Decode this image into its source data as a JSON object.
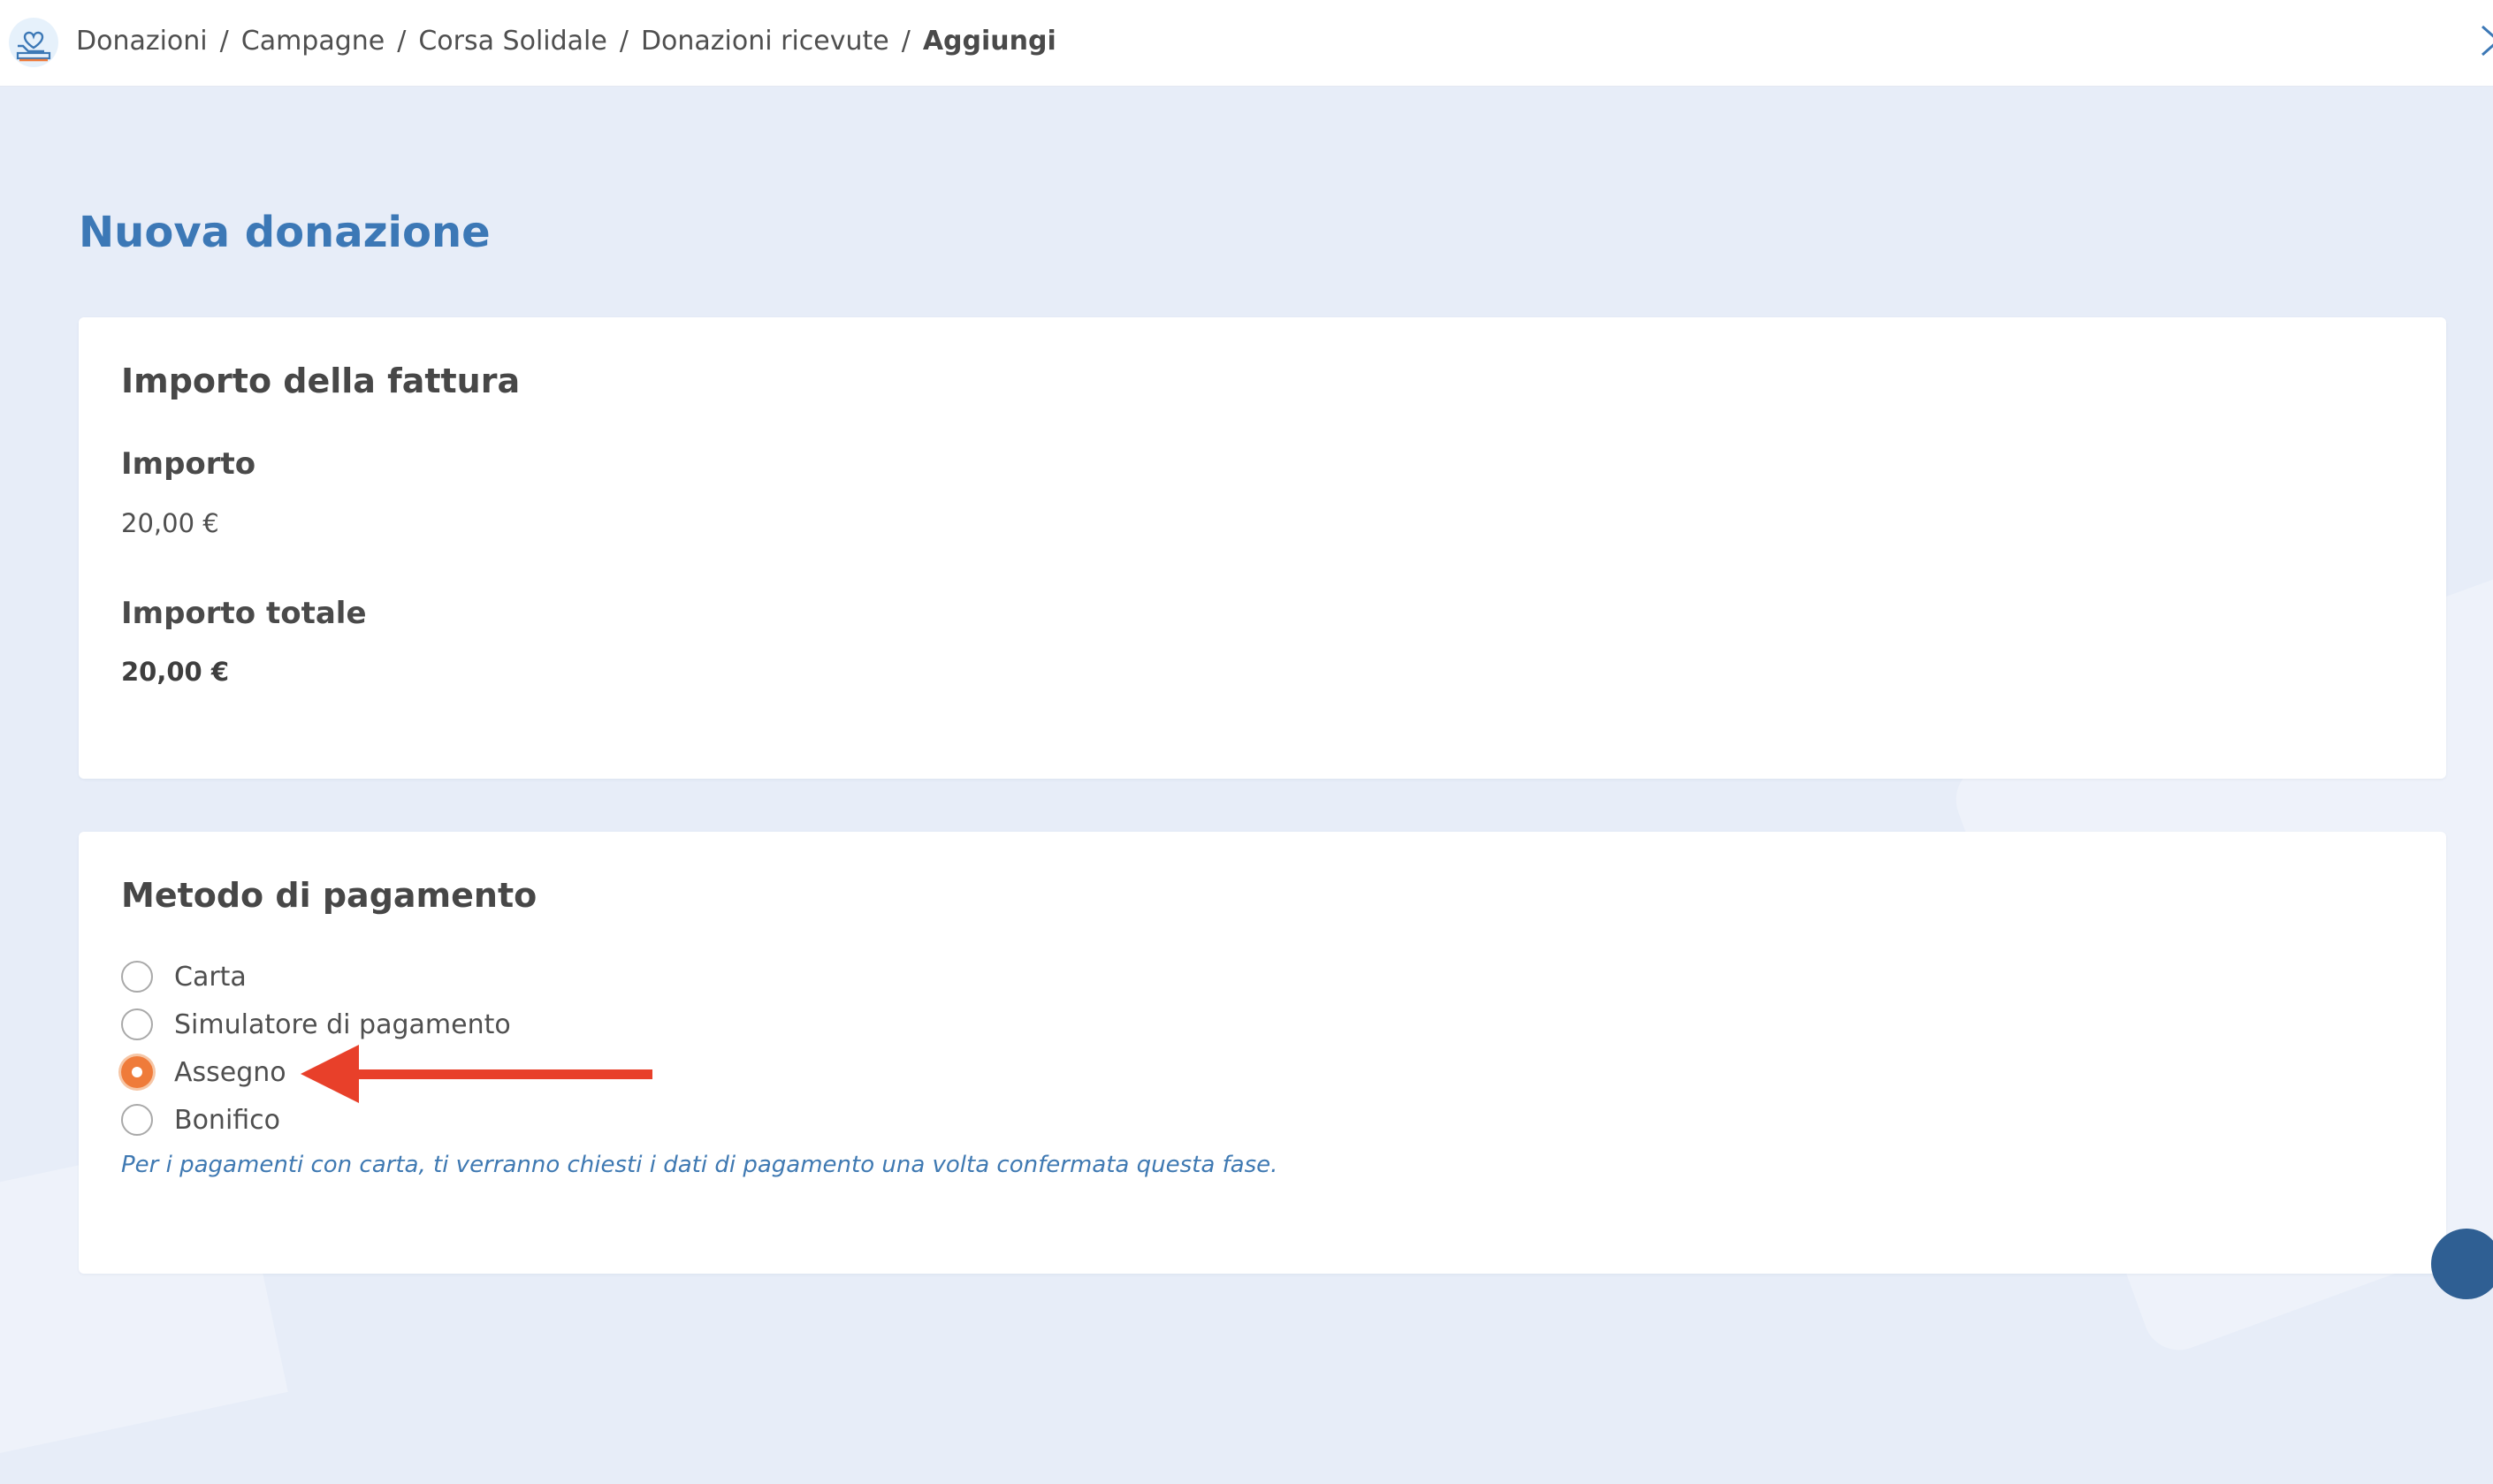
{
  "breadcrumb": {
    "items": [
      "Donazioni",
      "Campagne",
      "Corsa Solidale",
      "Donazioni ricevute"
    ],
    "current": "Aggiungi",
    "separator": "/"
  },
  "page": {
    "title": "Nuova donazione"
  },
  "invoice": {
    "heading": "Importo della fattura",
    "amount_label": "Importo",
    "amount_value": "20,00 €",
    "total_label": "Importo totale",
    "total_value": "20,00 €"
  },
  "payment": {
    "heading": "Metodo di pagamento",
    "options": [
      {
        "label": "Carta",
        "selected": false
      },
      {
        "label": "Simulatore di pagamento",
        "selected": false
      },
      {
        "label": "Assegno",
        "selected": true
      },
      {
        "label": "Bonifico",
        "selected": false
      }
    ],
    "hint": "Per i pagamenti con carta, ti verranno chiesti i dati di pagamento una volta confermata questa fase."
  },
  "icons": {
    "logo": "heart-hand-icon",
    "close": "close-icon"
  },
  "colors": {
    "accent": "#3c78b6",
    "radio_selected": "#ef7b3a",
    "annotation_arrow": "#e8402a",
    "background": "#e7edf8"
  }
}
